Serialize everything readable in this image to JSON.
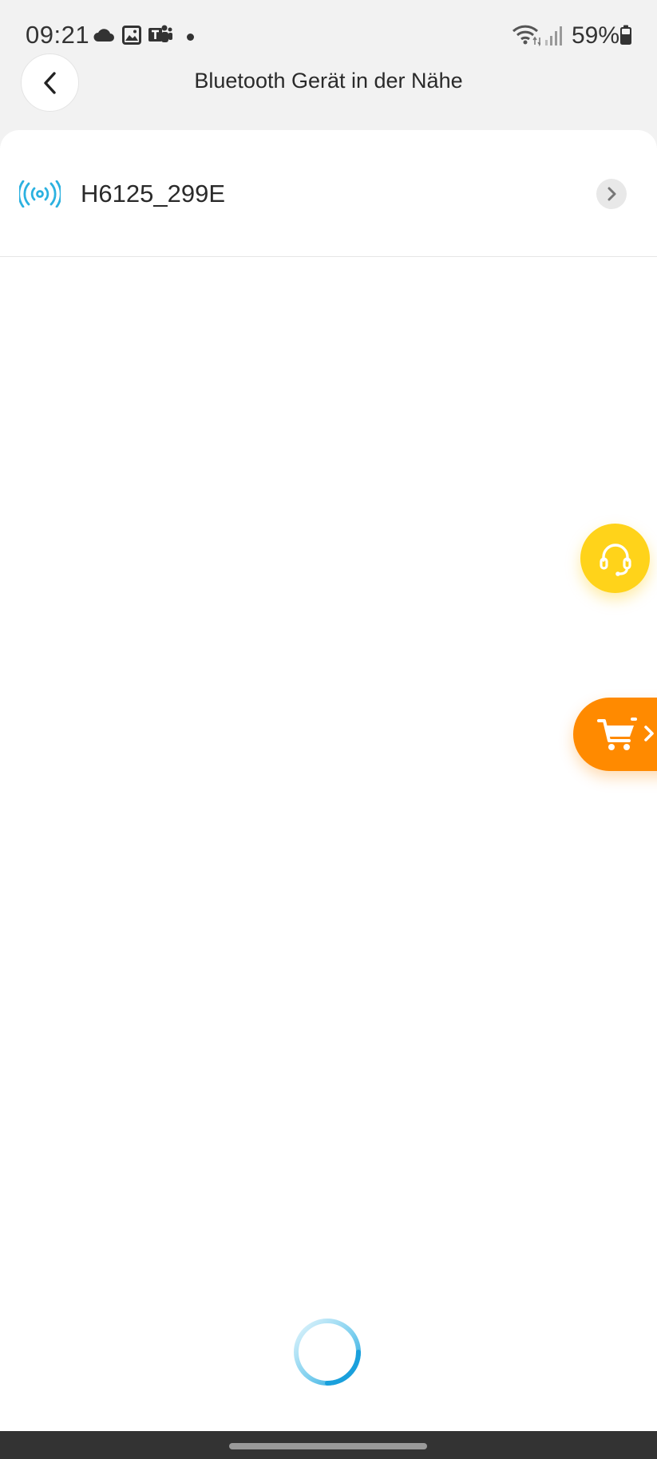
{
  "status_bar": {
    "time": "09:21",
    "battery": "59%",
    "notification_icons": [
      "cloud-icon",
      "gallery-icon",
      "teams-icon",
      "dot-icon"
    ],
    "system_icons": [
      "wifi-icon",
      "signal-icon",
      "battery-icon"
    ]
  },
  "header": {
    "title": "Bluetooth Gerät in der Nähe",
    "back_icon": "chevron-left-icon"
  },
  "devices": [
    {
      "name": "H6125_299E",
      "icon": "bluetooth-signal-icon"
    }
  ],
  "floating": {
    "support_icon": "headset-icon",
    "shop_icon": "cart-icon"
  },
  "colors": {
    "accent_blue": "#2bb1e0",
    "support_yellow": "#ffd31a",
    "shop_orange": "#ff8a00",
    "background": "#f2f2f2",
    "card": "#ffffff"
  }
}
